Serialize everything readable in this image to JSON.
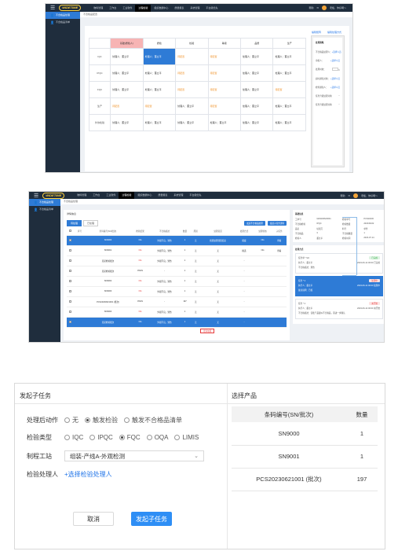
{
  "app": {
    "logo": "WIDETIME",
    "nav": [
      "物料管理",
      "工作台",
      "工业软件",
      "过程检验",
      "组织数据中心",
      "质量报表",
      "系统管理",
      "平台级优先"
    ],
    "active_nav_index": 3,
    "user": "老板，你好啊～",
    "help": "帮助"
  },
  "sidebar": {
    "items": [
      "不合格品处理",
      "不合格品清单"
    ]
  },
  "shot1": {
    "breadcrumb": "不合格品配置",
    "links": [
      "编辑矩阵",
      "编辑处理方式"
    ],
    "columns": [
      "",
      "基础(质检人)",
      "质检",
      "检验",
      "等级",
      "品质",
      "生产"
    ],
    "rows": [
      {
        "label": "IQC",
        "cells": [
          "处理人：董立平",
          "处理人：董立平",
          "待配置",
          "待配置",
          "处理人：董立平",
          "处理人：董立平"
        ]
      },
      {
        "label": "IPQC",
        "cells": [
          "处理人：董立平",
          "处理人：董立平",
          "待配置",
          "待配置",
          "处理人：董立平",
          "处理人：董立平"
        ]
      },
      {
        "label": "FQC",
        "cells": [
          "处理人：董立平",
          "处理人：董立平",
          "待配置",
          "待配置",
          "处理人：董立平",
          "待配置"
        ]
      },
      {
        "label": "生产",
        "cells": [
          "待配置",
          "待配置",
          "处理人：董立平",
          "待配置",
          "处理人：董立平",
          "处理人：董立平"
        ]
      },
      {
        "label": "外协检验",
        "cells": [
          "处理人：董立平",
          "处理人：董立平",
          "处理人：董立平",
          "处理人：董立平",
          "处理人：董立平",
          "处理人：董立平"
        ]
      }
    ],
    "config": {
      "title": "处理策略",
      "rows": [
        {
          "k": "不合格品处理人：",
          "v": "+选择人员"
        },
        {
          "k": "审核人：",
          "v": "+选择人员"
        },
        {
          "k": "处理时效：",
          "v": "h"
        },
        {
          "k": "超时通知对象：",
          "v": "+选择人员"
        },
        {
          "k": "检查通知人：",
          "v": "+选择人员"
        },
        {
          "k": "任务升级处理对象",
          "v": ""
        },
        {
          "k": "任务升级处理对象",
          "v": ""
        }
      ]
    }
  },
  "shot2": {
    "breadcrumb": "不合格品处理",
    "panel_title": "详情信息",
    "tabs": [
      "待处理",
      "已处理"
    ],
    "buttons": [
      "发起不合格品处理",
      "发起子任务流转"
    ],
    "headers": [
      "",
      "序号",
      "条码编号(SN/批次)",
      "检验结果",
      "不合格描述",
      "数量",
      "原因",
      "处理意见",
      "处理方式",
      "处理状态",
      "子任务"
    ],
    "rows": [
      {
        "no": "SN9000",
        "result": "NG",
        "desc": "外观不良，划伤",
        "qty": "1",
        "reason": "无",
        "opinion": "按照处理流程结束",
        "method": "报废",
        "status": "NG",
        "sub": "查看",
        "blue": true
      },
      {
        "no": "SN9001",
        "result": "NG",
        "desc": "外观不良，划伤",
        "qty": "1",
        "reason": "无",
        "opinion": "无",
        "method": "挑选",
        "status": "NG",
        "sub": "查看",
        "blue": false
      },
      {
        "no": "某某检验批次",
        "result": "NG",
        "desc": "外观不良，划伤",
        "qty": "1",
        "reason": "无",
        "opinion": "无",
        "method": "-",
        "status": "",
        "sub": "",
        "blue": false
      },
      {
        "no": "某某检验批次",
        "result": "PASS",
        "desc": "-",
        "qty": "1",
        "reason": "无",
        "opinion": "无",
        "method": "-",
        "status": "",
        "sub": "",
        "blue": false
      },
      {
        "no": "SN9002",
        "result": "NG",
        "desc": "外观不良，划伤",
        "qty": "1",
        "reason": "无",
        "opinion": "无",
        "method": "-",
        "status": "",
        "sub": "",
        "blue": false
      },
      {
        "no": "SN9003",
        "result": "NG",
        "desc": "外观不良，划伤",
        "qty": "1",
        "reason": "无",
        "opinion": "无",
        "method": "-",
        "status": "",
        "sub": "",
        "blue": false
      },
      {
        "no": "PCS20230621001 (批次)",
        "result": "PASS",
        "desc": "-",
        "qty": "197",
        "reason": "无",
        "opinion": "无",
        "method": "-",
        "status": "",
        "sub": "",
        "blue": false
      },
      {
        "no": "SN9004",
        "result": "NG",
        "desc": "外观不良，划伤",
        "qty": "1",
        "reason": "无",
        "opinion": "无",
        "method": "-",
        "status": "",
        "sub": "",
        "blue": false
      },
      {
        "no": "某某检验批次",
        "result": "NG",
        "desc": "外观不良，划伤",
        "qty": "1",
        "reason": "无",
        "opinion": "无",
        "method": "-",
        "status": "",
        "sub": "",
        "blue": true
      }
    ],
    "pager": "更多加载",
    "info": {
      "title": "基础信息",
      "fields": [
        [
          "工单号",
          "GD9230620001",
          "检验单号",
          "PCS20230"
        ],
        [
          "不合格检验",
          "IPQC",
          "检验数量",
          "2023/06/22"
        ],
        [
          "品名",
          "切削刀",
          "料号",
          "单件"
        ],
        [
          "不合格品",
          "3",
          "不合格数量",
          "1"
        ],
        [
          "检验人",
          "董立平",
          "检验时间",
          "2023-07-14"
        ]
      ]
    },
    "tasks_title": "处理方式",
    "cards": [
      {
        "no": "任务单 * SO",
        "badge": "已完成",
        "badge_type": "green",
        "who": "执行人：董立平",
        "time": "2023-06-14 00:00 已完成",
        "note": "不合格描述：划伤",
        "sel": false
      },
      {
        "no": "任务 * 2",
        "badge": "处理中",
        "badge_type": "red",
        "who": "执行人：董立平",
        "time": "2023-06-14 00:00 处理中",
        "note": "备注说明：已核",
        "sel": true
      },
      {
        "no": "任务 * 2",
        "badge": "未开始",
        "badge_type": "red",
        "who": "执行人：董立平",
        "time": "2023-06-14 00:00 未开始",
        "note": "不合格描述：该批产品疑似不合格品，需进一步确认",
        "sel": false
      }
    ]
  },
  "dialog": {
    "title": "发起子任务",
    "right_title": "选择产品",
    "action": {
      "label": "处理后动作",
      "options": [
        "无",
        "触发检验",
        "触发不合格品清单"
      ],
      "selected": 1
    },
    "inspect": {
      "label": "检验类型",
      "options": [
        "IQC",
        "IPQC",
        "FQC",
        "OQA",
        "LIMIS"
      ],
      "selected": 2
    },
    "station": {
      "label": "制程工站",
      "value": "组装-产线A-外观检测"
    },
    "handler": {
      "label": "检验处理人",
      "link": "+选择检验处理人"
    },
    "cancel": "取消",
    "submit": "发起子任务",
    "products": {
      "headers": [
        "条码编号(SN/批次)",
        "数量"
      ],
      "rows": [
        {
          "code": "SN9000",
          "qty": "1"
        },
        {
          "code": "SN9001",
          "qty": "1"
        },
        {
          "code": "PCS20230621001 (批次)",
          "qty": "197"
        }
      ]
    }
  }
}
